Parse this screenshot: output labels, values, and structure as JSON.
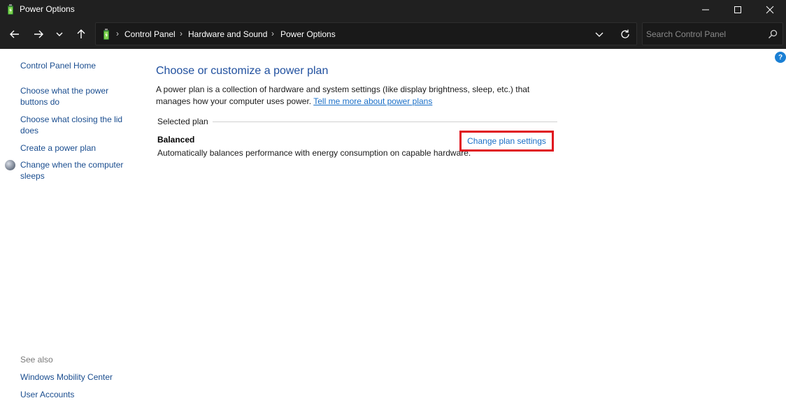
{
  "window": {
    "title": "Power Options",
    "icon": "power-options-icon"
  },
  "navigation": {
    "breadcrumbs": [
      "Control Panel",
      "Hardware and Sound",
      "Power Options"
    ],
    "search_placeholder": "Search Control Panel"
  },
  "sidebar": {
    "home_label": "Control Panel Home",
    "tasks": [
      {
        "label": "Choose what the power buttons do"
      },
      {
        "label": "Choose what closing the lid does"
      },
      {
        "label": "Create a power plan"
      },
      {
        "label": "Change when the computer sleeps",
        "icon": "moon-icon"
      }
    ],
    "see_also_label": "See also",
    "see_also_links": [
      {
        "label": "Windows Mobility Center"
      },
      {
        "label": "User Accounts"
      }
    ]
  },
  "main": {
    "title": "Choose or customize a power plan",
    "description": "A power plan is a collection of hardware and system settings (like display brightness, sleep, etc.) that manages how your computer uses power.",
    "learn_more_link": "Tell me more about power plans",
    "selected_plan_label": "Selected plan",
    "plan": {
      "name": "Balanced",
      "description": "Automatically balances performance with energy consumption on capable hardware.",
      "change_link": "Change plan settings"
    },
    "help_label": "?"
  },
  "colors": {
    "titlebar_bg": "#202020",
    "link": "#1a6fc7",
    "heading": "#1f4f9e",
    "highlight_border": "#e0141e"
  }
}
